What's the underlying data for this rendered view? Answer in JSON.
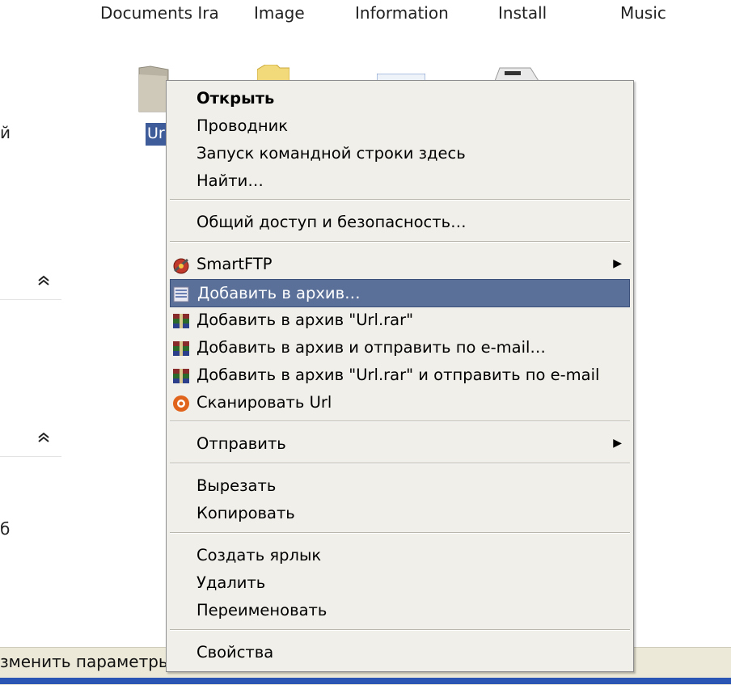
{
  "folders": [
    {
      "label": "Documents Ira"
    },
    {
      "label": "Image"
    },
    {
      "label": "Information"
    },
    {
      "label": "Install"
    },
    {
      "label": "Music"
    }
  ],
  "selected_folder_label": "Url",
  "left_pane": {
    "fragment_1": "й",
    "fragment_2": "б",
    "collapse_glyph": "≈"
  },
  "status_text": "зменить параметры)",
  "menu": {
    "open": "Открыть",
    "explorer": "Проводник",
    "cmd_here": "Запуск командной строки здесь",
    "find": "Найти…",
    "sharing": "Общий доступ и безопасность…",
    "smartftp": "SmartFTP",
    "add_archive": "Добавить в архив…",
    "add_archive_named": "Добавить в архив \"Url.rar\"",
    "add_archive_email": "Добавить в архив и отправить по e-mail…",
    "add_archive_named_email": "Добавить в архив \"Url.rar\" и отправить по e-mail",
    "scan": "Сканировать Url",
    "send_to": "Отправить",
    "cut": "Вырезать",
    "copy": "Копировать",
    "create_shortcut": "Создать ярлык",
    "delete": "Удалить",
    "rename": "Переименовать",
    "properties": "Свойства",
    "submenu_arrow": "▶"
  },
  "colors": {
    "selection": "#5a7099",
    "menu_bg": "#f1efe9"
  }
}
